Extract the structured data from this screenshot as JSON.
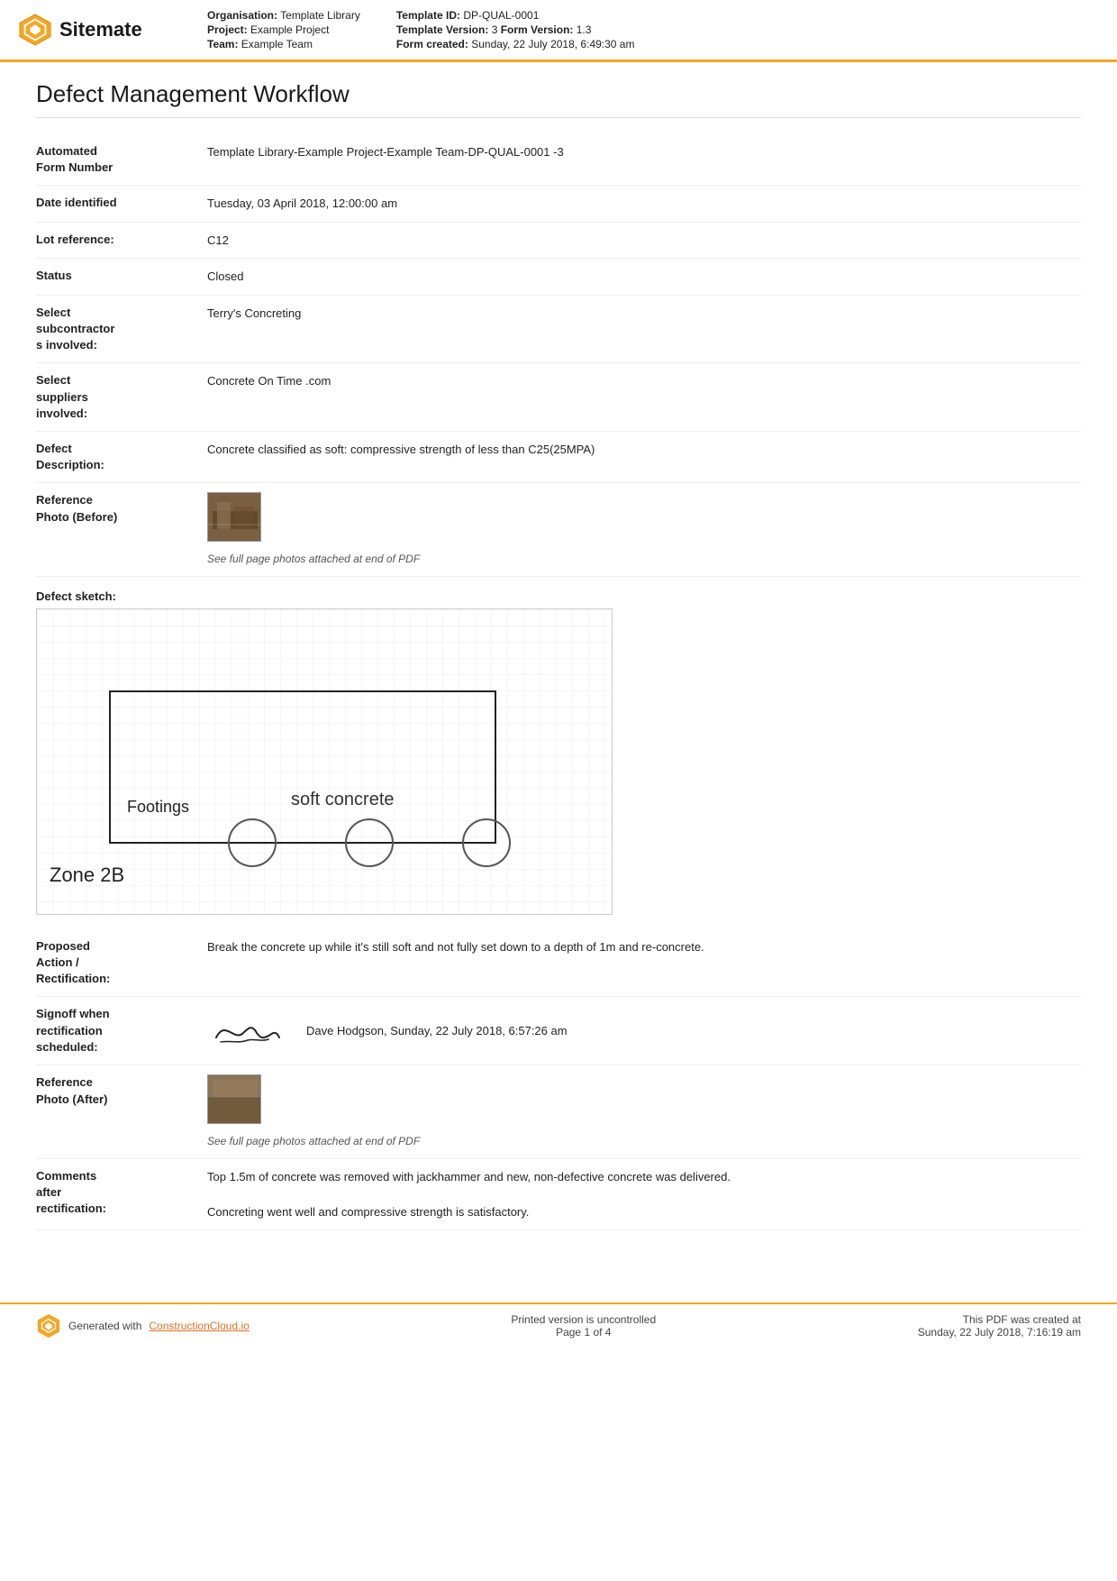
{
  "header": {
    "logo_text": "Sitemate",
    "org_label": "Organisation:",
    "org_value": "Template Library",
    "project_label": "Project:",
    "project_value": "Example Project",
    "team_label": "Team:",
    "team_value": "Example Team",
    "template_id_label": "Template ID:",
    "template_id_value": "DP-QUAL-0001",
    "template_version_label": "Template Version:",
    "template_version_value": "3",
    "form_version_label": "Form Version:",
    "form_version_value": "1.3",
    "form_created_label": "Form created:",
    "form_created_value": "Sunday, 22 July 2018, 6:49:30 am"
  },
  "document": {
    "title": "Defect Management Workflow"
  },
  "fields": [
    {
      "label": "Automated Form Number",
      "value": "Template Library-Example Project-Example Team-DP-QUAL-0001  -3"
    },
    {
      "label": "Date identified",
      "value": "Tuesday, 03 April 2018, 12:00:00 am"
    },
    {
      "label": "Lot reference:",
      "value": "C12"
    },
    {
      "label": "Status",
      "value": "Closed"
    },
    {
      "label": "Select subcontractors involved:",
      "value": "Terry's Concreting"
    },
    {
      "label": "Select suppliers involved:",
      "value": "Concrete On Time .com"
    },
    {
      "label": "Defect Description:",
      "value": "Concrete classified as soft: compressive strength of less than C25(25MPA)"
    },
    {
      "label": "Reference Photo (Before)",
      "value": "See full page photos attached at end of PDF",
      "has_photo": true
    }
  ],
  "sketch": {
    "label": "Defect sketch:",
    "soft_concrete_text": "soft concrete",
    "footing_text": "Footings",
    "zone_text": "Zone 2B"
  },
  "fields2": [
    {
      "label": "Proposed Action / Rectification:",
      "value": "Break the concrete up while it's still soft and not fully set down to a depth of 1m and re-concrete."
    },
    {
      "label": "Signoff when rectification scheduled:",
      "signature_name": "Dave Hodgson, Sunday, 22 July 2018, 6:57:26 am",
      "has_signature": true
    },
    {
      "label": "Reference Photo (After)",
      "value": "See full page photos attached at end of PDF",
      "has_photo": true
    },
    {
      "label": "Comments after rectification:",
      "value": "Top 1.5m of concrete was removed with jackhammer and new, non-defective concrete was delivered.\n\nConcreting went well and compressive strength is satisfactory."
    }
  ],
  "footer": {
    "generated_text": "Generated with",
    "link_text": "ConstructionCloud.io",
    "uncontrolled_text": "Printed version is uncontrolled",
    "page_text": "Page 1 of 4",
    "pdf_created_text": "This PDF was created at",
    "pdf_created_date": "Sunday, 22 July 2018, 7:16:19 am"
  }
}
